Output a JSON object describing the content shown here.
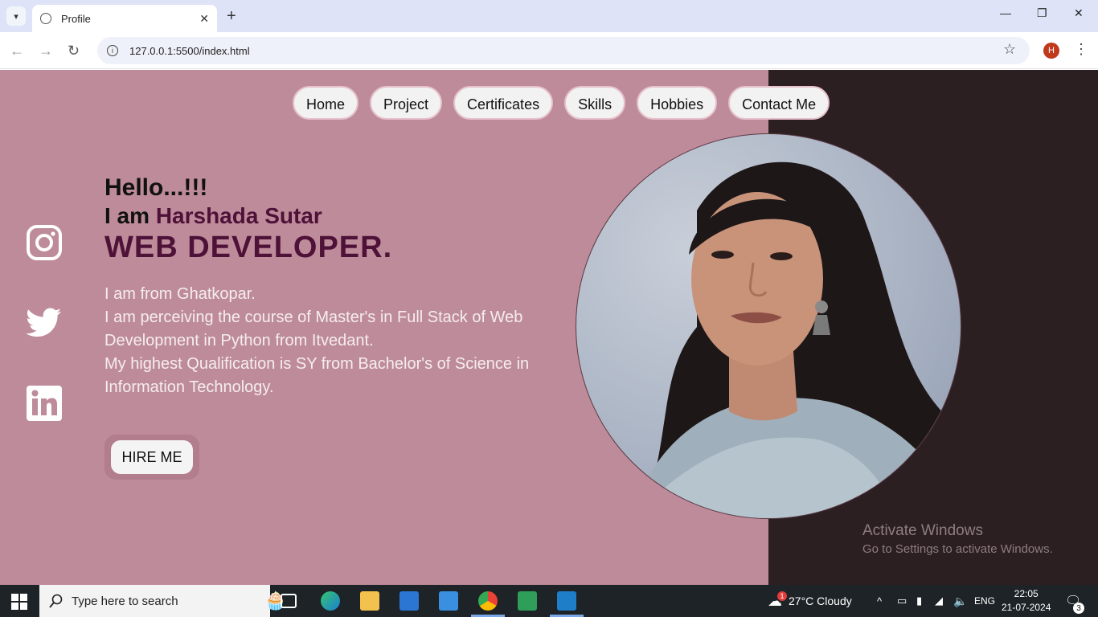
{
  "browser": {
    "tab_title": "Profile",
    "url": "127.0.0.1:5500/index.html",
    "profile_initial": "H"
  },
  "nav": {
    "items": [
      "Home",
      "Project",
      "Certificates",
      "Skills",
      "Hobbies",
      "Contact Me"
    ]
  },
  "hero": {
    "greeting": "Hello...!!!",
    "iam_prefix": "I am ",
    "name": "Harshada Sutar",
    "role": "WEB DEVELOPER.",
    "bio": [
      "I am from Ghatkopar.",
      "I am perceiving the course of Master's in Full Stack of Web Development in Python from Itvedant.",
      "My highest Qualification is SY from Bachelor's of Science in Information Technology."
    ],
    "hire_label": "HIRE ME"
  },
  "socials": [
    "instagram-icon",
    "twitter-icon",
    "linkedin-icon"
  ],
  "watermark": {
    "line1": "Activate Windows",
    "line2": "Go to Settings to activate Windows."
  },
  "taskbar": {
    "search_placeholder": "Type here to search",
    "weather": "27°C  Cloudy",
    "lang": "ENG",
    "time": "22:05",
    "date": "21-07-2024",
    "notif_count": "3",
    "badge_count": "1"
  },
  "colors": {
    "page_bg": "#be8b9a",
    "dark_panel": "#2c1f22",
    "accent": "#4e1238"
  }
}
